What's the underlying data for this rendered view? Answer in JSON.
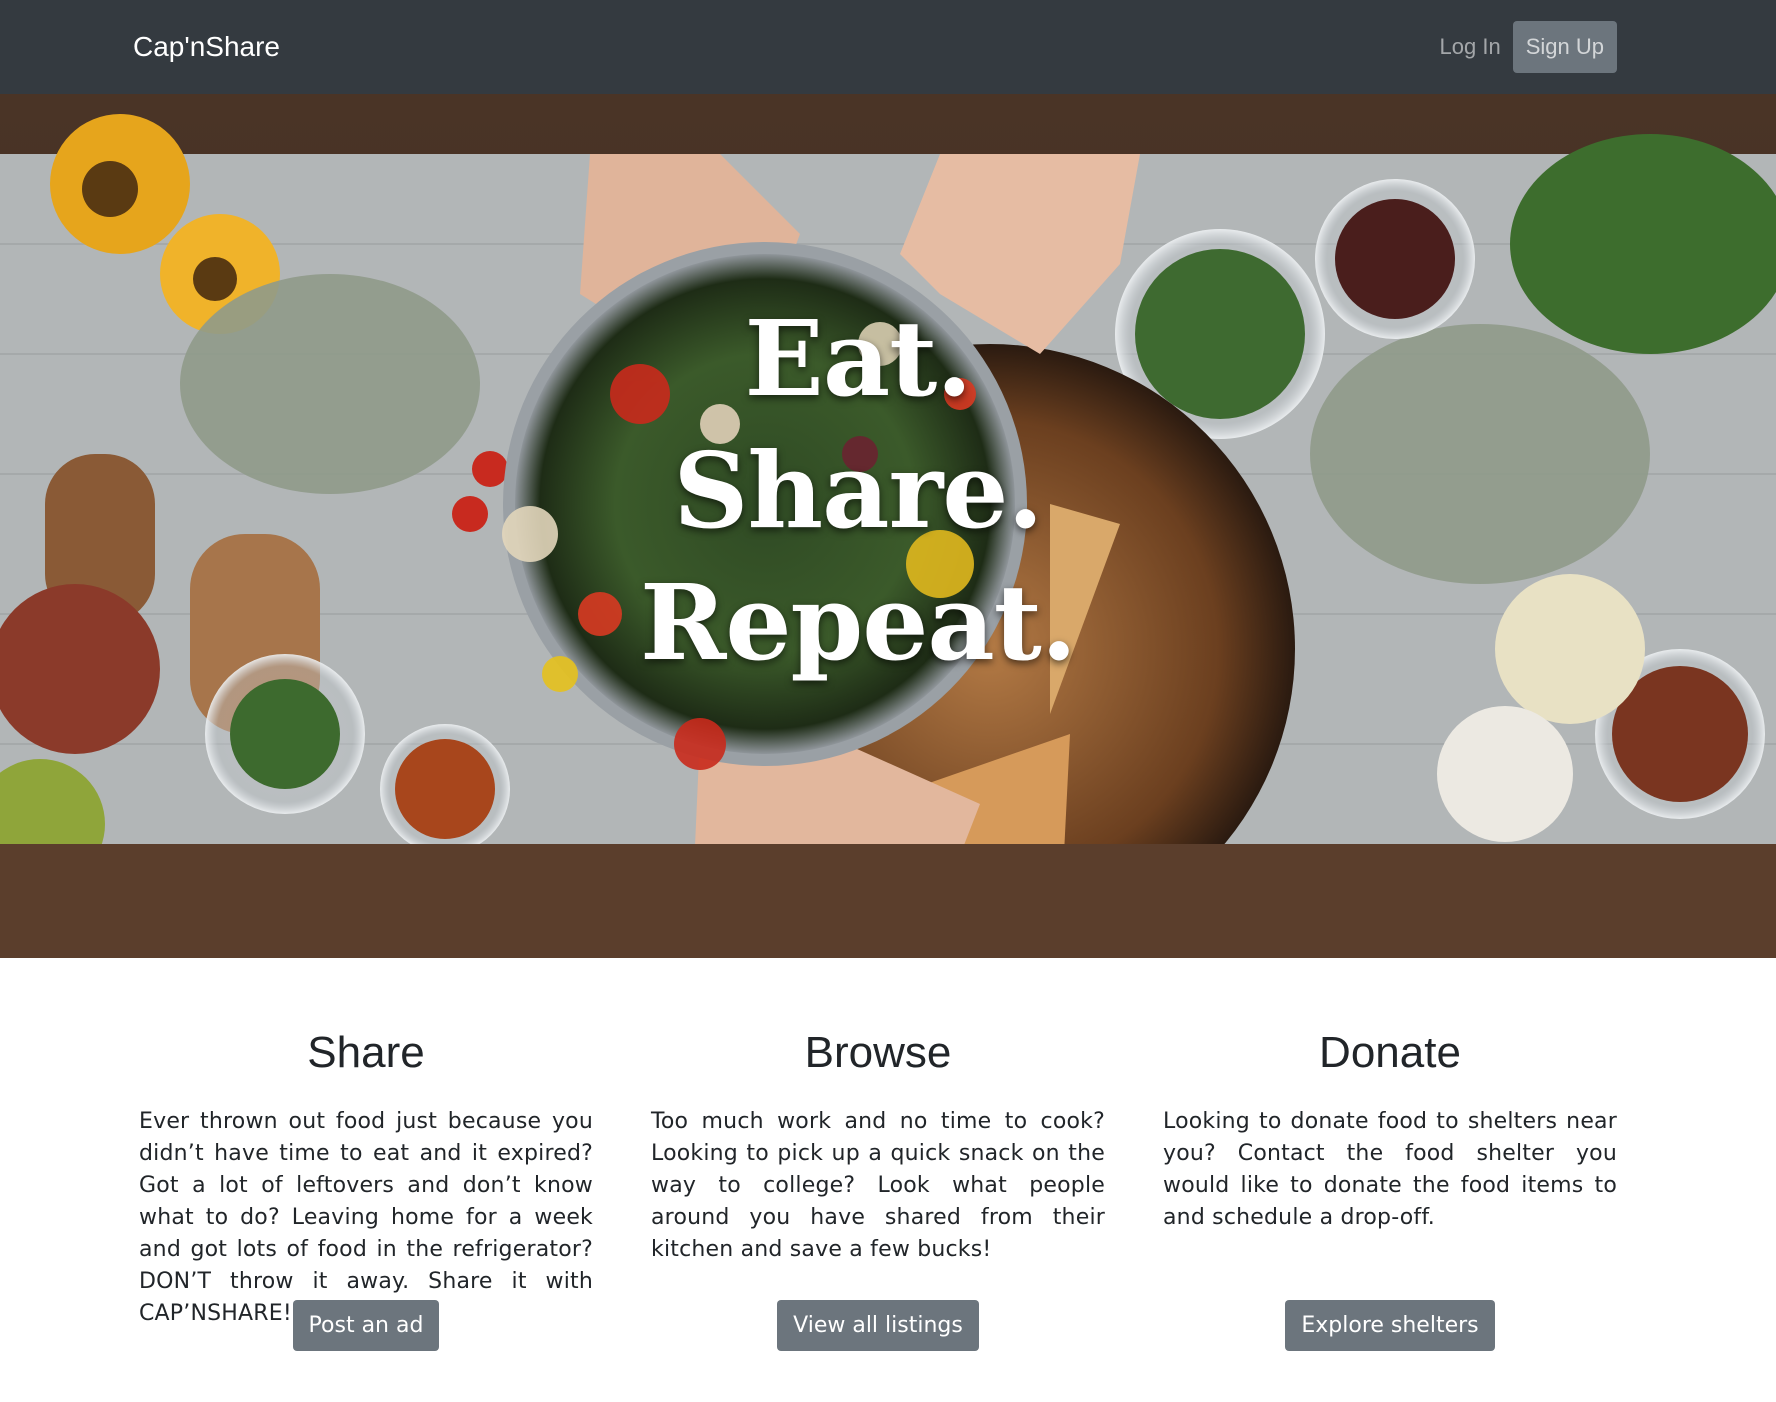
{
  "navbar": {
    "brand": "Cap'nShare",
    "login_label": "Log In",
    "signup_label": "Sign Up"
  },
  "hero": {
    "lines": [
      "Eat.",
      "Share.",
      "Repeat."
    ]
  },
  "features": [
    {
      "title": "Share",
      "text": "Ever thrown out food just because you didn’t have time to eat and it expired? Got a lot of leftovers and don’t know what to do? Leaving home for a week and got lots of food in the refrigerator? DON’T throw it away. Share it with CAP’NSHARE!",
      "button": "Post an ad"
    },
    {
      "title": "Browse",
      "text": "Too much work and no time to cook? Looking to pick up a quick snack on the way to college? Look what people around you have shared from their kitchen and save a few bucks!",
      "button": "View all listings"
    },
    {
      "title": "Donate",
      "text": "Looking to donate food to shelters near you? Contact the food shelter you would like to donate the food items to and schedule a drop-off.",
      "button": "Explore shelters"
    }
  ],
  "colors": {
    "navbar_bg": "#343a40",
    "button_bg": "#6c757d",
    "text": "#212529"
  }
}
